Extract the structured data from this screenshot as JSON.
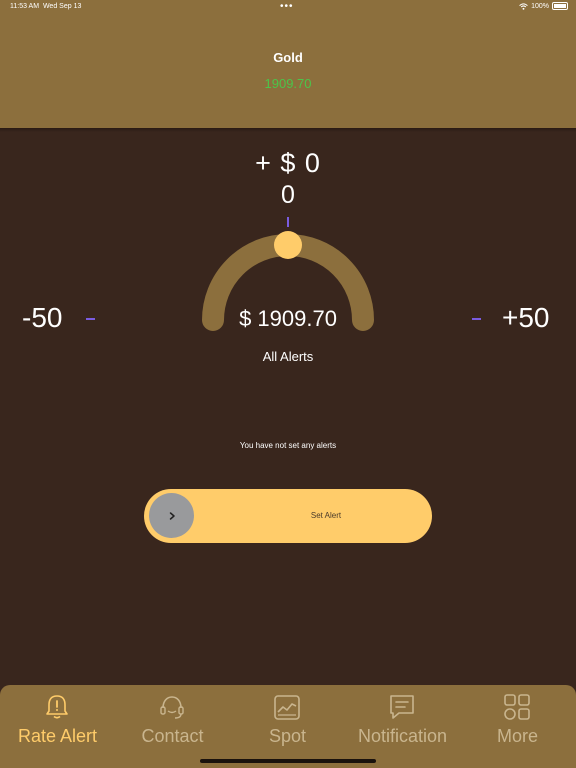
{
  "status_bar": {
    "time": "11:53 AM",
    "date": "Wed Sep 13",
    "dots": "•••",
    "battery": "100%"
  },
  "header": {
    "title": "Gold",
    "price": "1909.70"
  },
  "alert": {
    "offset": "+ $ 0",
    "count": "0",
    "gauge_value": "$ 1909.70",
    "gauge_level": 0.5,
    "caption": "All Alerts",
    "range_min": "-50",
    "range_max": "+50"
  },
  "empty_message": "You have not set any alerts",
  "slider": {
    "label": "Set Alert",
    "knob_icon": "chevron-right-icon"
  },
  "tabs": [
    {
      "label": "Rate Alert",
      "icon": "bell-alert-icon",
      "active": true
    },
    {
      "label": "Contact",
      "icon": "headset-icon",
      "active": false
    },
    {
      "label": "Spot",
      "icon": "chart-card-icon",
      "active": false
    },
    {
      "label": "Notification",
      "icon": "message-icon",
      "active": false
    },
    {
      "label": "More",
      "icon": "grid-icon",
      "active": false
    }
  ],
  "colors": {
    "background": "#39261d",
    "header": "#8c6f3d",
    "accent": "#ffcc6a",
    "price_green": "#4cc44a",
    "tick_purple": "#7a5ce0"
  }
}
